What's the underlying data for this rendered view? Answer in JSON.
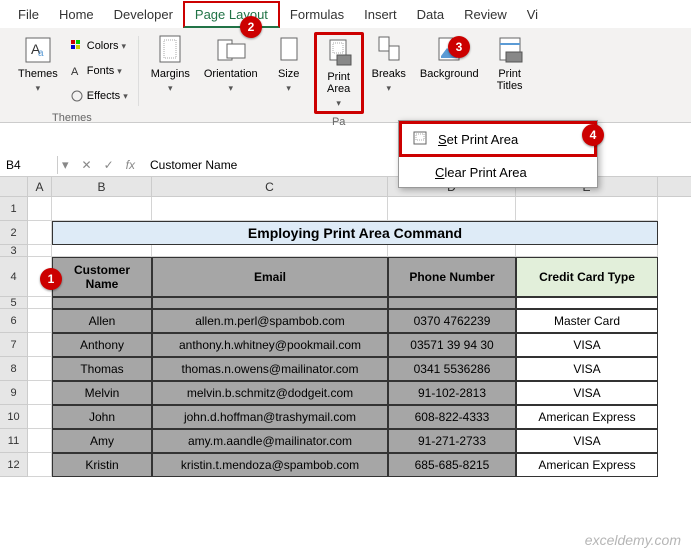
{
  "tabs": [
    "File",
    "Home",
    "Developer",
    "Page Layout",
    "Formulas",
    "Insert",
    "Data",
    "Review",
    "Vi"
  ],
  "active_tab": "Page Layout",
  "ribbon": {
    "themes": {
      "label": "Themes",
      "main": "Themes",
      "colors": "Colors",
      "fonts": "Fonts",
      "effects": "Effects"
    },
    "page_setup": {
      "label": "Pa",
      "margins": "Margins",
      "orientation": "Orientation",
      "size": "Size",
      "print_area": "Print\nArea",
      "breaks": "Breaks",
      "background": "Background",
      "print_titles": "Print\nTitles"
    }
  },
  "dropdown": {
    "set": "Set Print Area",
    "clear": "Clear Print Area"
  },
  "formula_bar": {
    "name": "B4",
    "value": "Customer Name"
  },
  "columns": [
    "A",
    "B",
    "C",
    "D",
    "E"
  ],
  "title": "Employing Print Area Command",
  "headers": [
    "Customer Name",
    "Email",
    "Phone Number",
    "Credit Card Type"
  ],
  "rows": [
    {
      "name": "Allen",
      "email": "allen.m.perl@spambob.com",
      "phone": "0370 4762239",
      "card": "Master Card"
    },
    {
      "name": "Anthony",
      "email": "anthony.h.whitney@pookmail.com",
      "phone": "03571 39 94 30",
      "card": "VISA"
    },
    {
      "name": "Thomas",
      "email": "thomas.n.owens@mailinator.com",
      "phone": "0341 5536286",
      "card": "VISA"
    },
    {
      "name": "Melvin",
      "email": "melvin.b.schmitz@dodgeit.com",
      "phone": "91-102-2813",
      "card": "VISA"
    },
    {
      "name": "John",
      "email": "john.d.hoffman@trashymail.com",
      "phone": "608-822-4333",
      "card": "American Express"
    },
    {
      "name": "Amy",
      "email": "amy.m.aandle@mailinator.com",
      "phone": "91-271-2733",
      "card": "VISA"
    },
    {
      "name": "Kristin",
      "email": "kristin.t.mendoza@spambob.com",
      "phone": "685-685-8215",
      "card": "American Express"
    }
  ],
  "watermark": "exceldemy.com",
  "callouts": {
    "c1": "1",
    "c2": "2",
    "c3": "3",
    "c4": "4"
  }
}
